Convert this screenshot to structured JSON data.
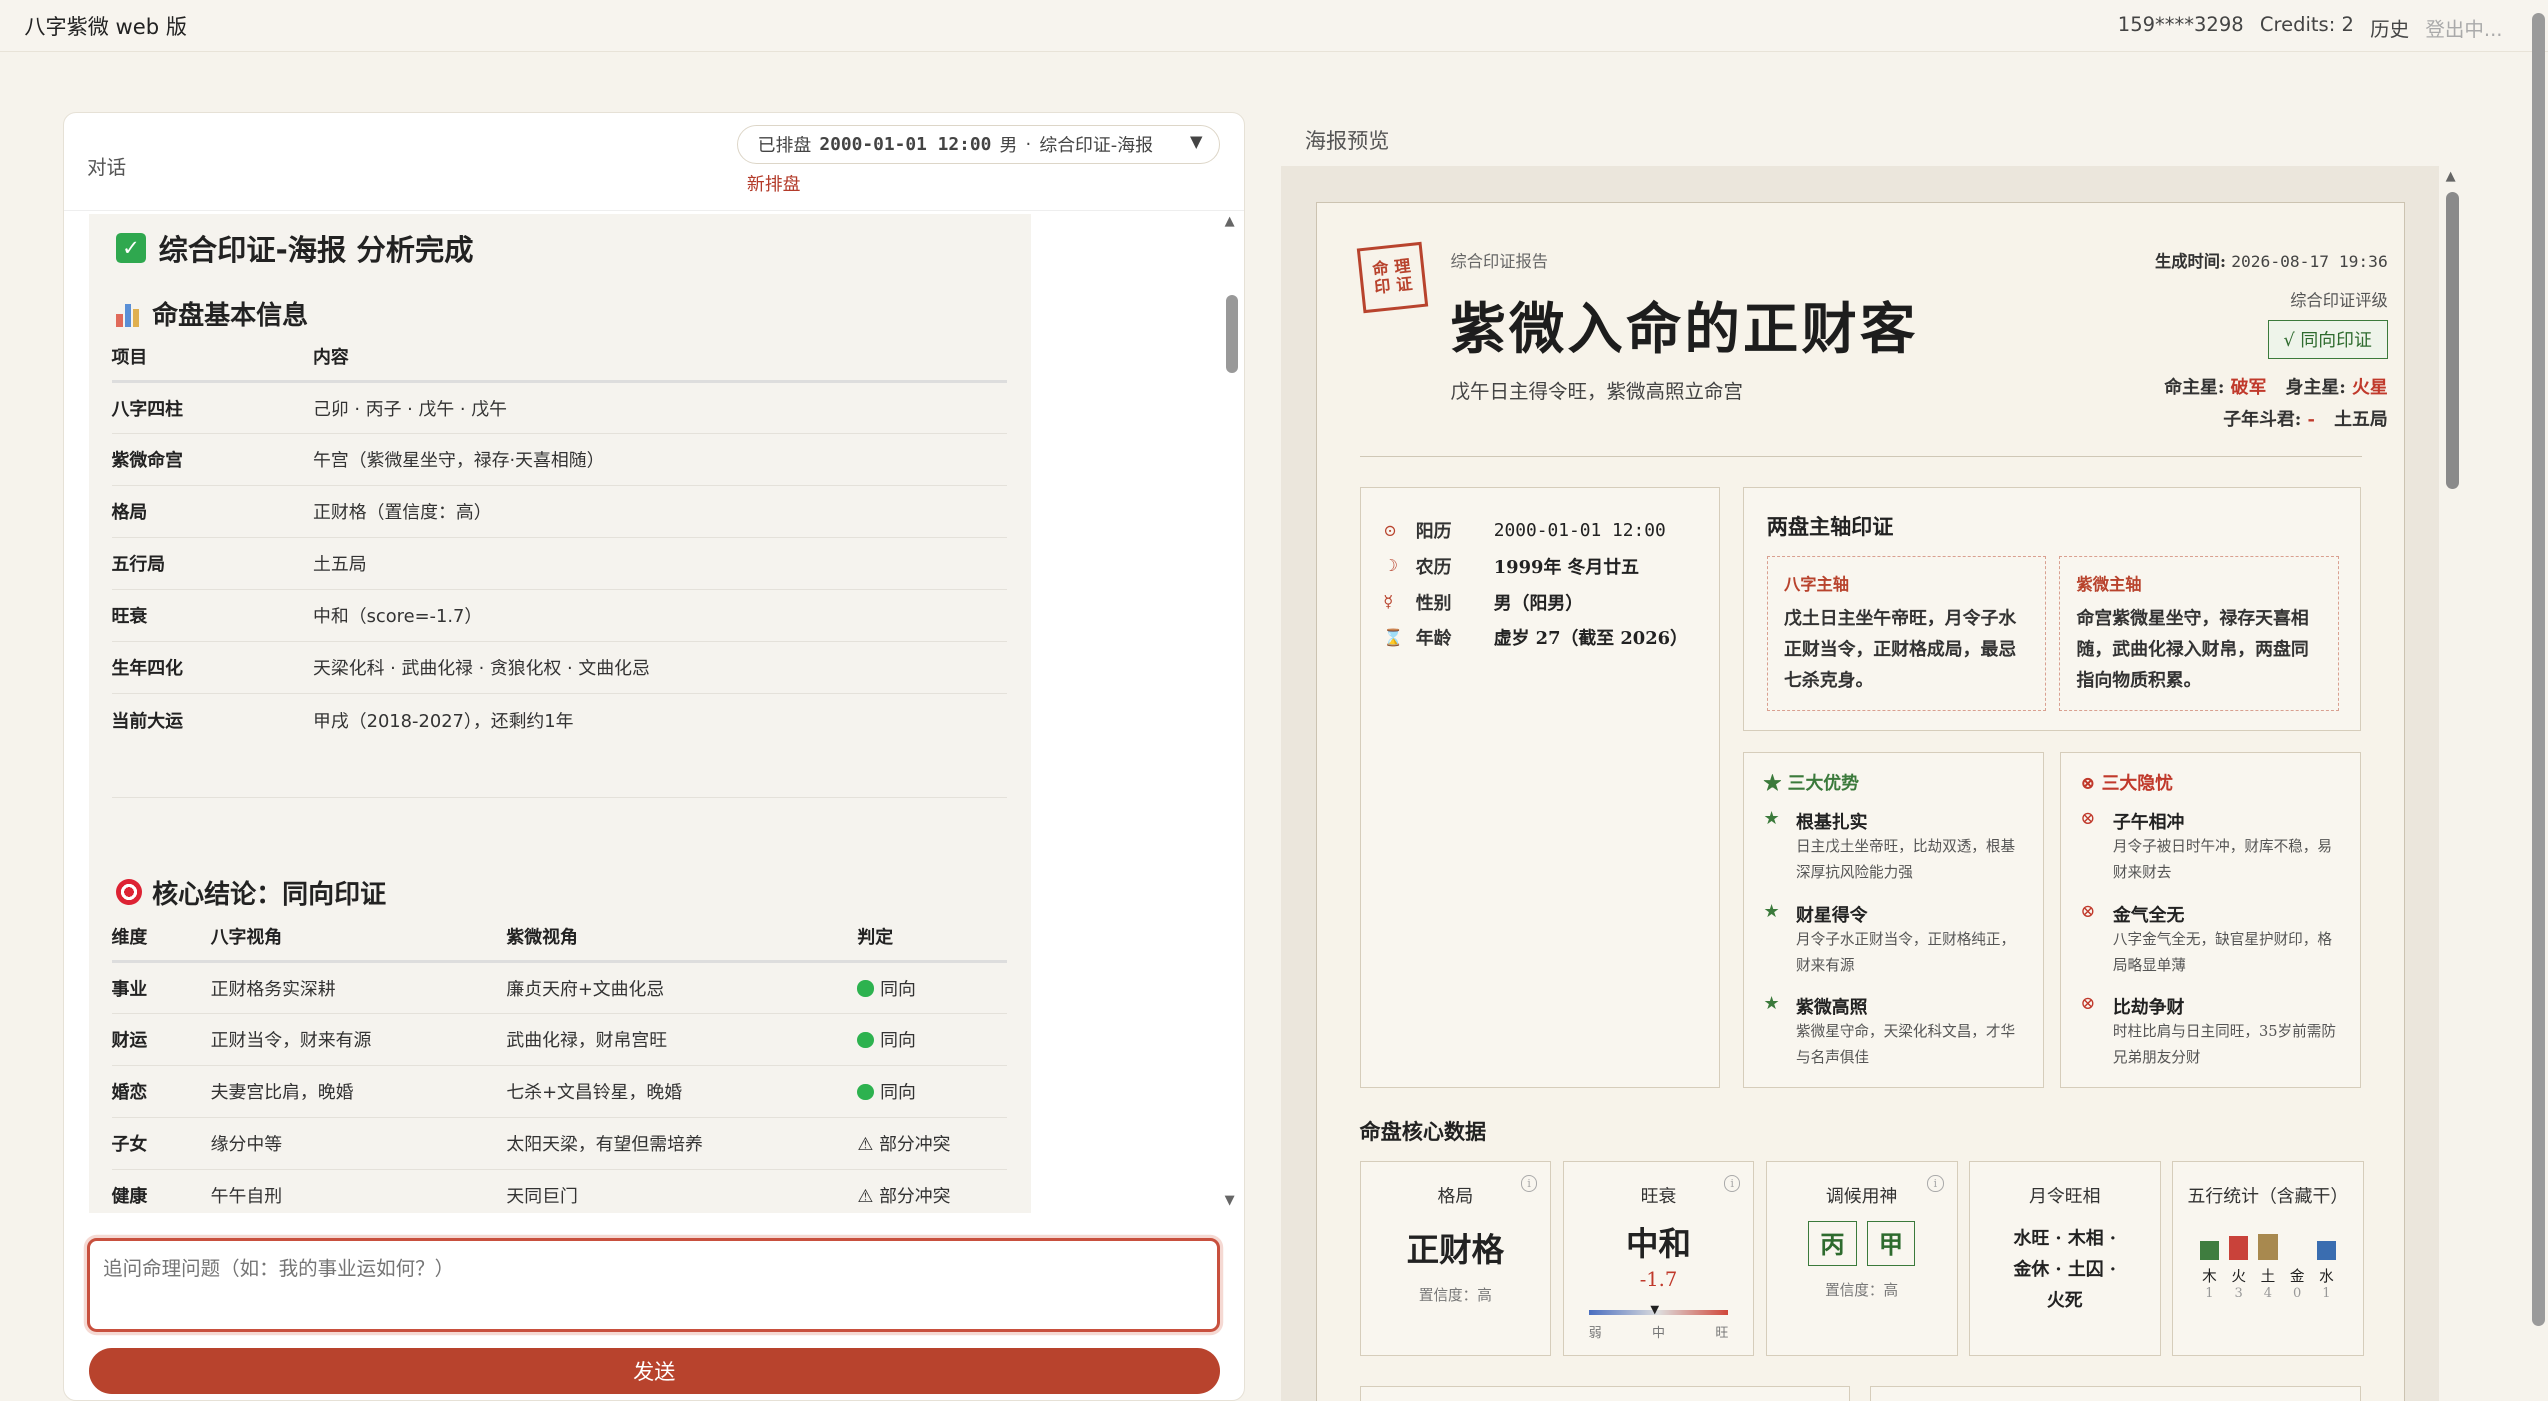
{
  "app": {
    "title": "八字紫微 web 版"
  },
  "topnav": {
    "phone": "159****3298",
    "credits": "Credits: 2",
    "history": "历史",
    "logout": "登出中..."
  },
  "chat": {
    "title": "对话",
    "selector": {
      "status": "已排盘",
      "datetime": "2000-01-01 12:00",
      "gender": "男",
      "sep": "·",
      "mode": "综合印证-海报"
    },
    "new_chart": "新排盘",
    "heading": "综合印证-海报 分析完成",
    "basic": {
      "heading": "命盘基本信息",
      "headers": [
        "项目",
        "内容"
      ],
      "rows": [
        {
          "k": "八字四柱",
          "v": "己卯 · 丙子 · 戊午 · 戊午"
        },
        {
          "k": "紫微命宫",
          "v": "午宫（紫微星坐守，禄存·天喜相随）"
        },
        {
          "k": "格局",
          "v": "正财格（置信度：高）"
        },
        {
          "k": "五行局",
          "v": "土五局"
        },
        {
          "k": "旺衰",
          "v": "中和（score=-1.7）"
        },
        {
          "k": "生年四化",
          "v": "天梁化科 · 武曲化禄 · 贪狼化权 · 文曲化忌"
        },
        {
          "k": "当前大运",
          "v": "甲戌（2018-2027），还剩约1年"
        }
      ]
    },
    "core": {
      "heading": "核心结论：同向印证",
      "headers": [
        "维度",
        "八字视角",
        "紫微视角",
        "判定"
      ],
      "rows": [
        {
          "a": "事业",
          "b": "正财格务实深耕",
          "c": "廉贞天府+文曲化忌",
          "d": "同向",
          "ok": true
        },
        {
          "a": "财运",
          "b": "正财当令，财来有源",
          "c": "武曲化禄，财帛宫旺",
          "d": "同向",
          "ok": true
        },
        {
          "a": "婚恋",
          "b": "夫妻宫比肩，晚婚",
          "c": "七杀+文昌铃星，晚婚",
          "d": "同向",
          "ok": true
        },
        {
          "a": "子女",
          "b": "缘分中等",
          "c": "太阳天梁，有望但需培养",
          "d": "⚠ 部分冲突",
          "ok": false
        },
        {
          "a": "健康",
          "b": "午午自刑",
          "c": "天同巨门",
          "d": "⚠ 部分冲突",
          "ok": false
        }
      ]
    },
    "input_placeholder": "追问命理问题（如：我的事业运如何？）",
    "send": "发送"
  },
  "preview": {
    "title": "海报预览",
    "seal": [
      "命 理",
      "印 证"
    ],
    "kicker": "综合印证报告",
    "headline": "紫微入命的正财客",
    "subtitle": "戊午日主得令旺，紫微高照立命宫",
    "gen_label": "生成时间:",
    "gen_time": "2026-08-17 19:36",
    "grade_label": "综合印证评级",
    "badge": "√ 同向印证",
    "ming_label": "命主星:",
    "ming": "破军",
    "shen_label": "身主星:",
    "shen": "火星",
    "dou_label": "子年斗君:",
    "dou": "-",
    "ju": "土五局",
    "birth": [
      {
        "icon": "⊙",
        "label": "阳历",
        "value": "2000-01-01 12:00"
      },
      {
        "icon": "☽",
        "label": "农历",
        "value": "1999年 冬月廿五"
      },
      {
        "icon": "☿",
        "label": "性别",
        "value": "男（阳男）"
      },
      {
        "icon": "⌛",
        "label": "年龄",
        "value": "虚岁 27（截至 2026）"
      }
    ],
    "axis": {
      "heading": "两盘主轴印证",
      "bazi_t": "八字主轴",
      "bazi": "戊土日主坐午帝旺，月令子水正财当令，正财格成局，最忌七杀克身。",
      "ziwei_t": "紫微主轴",
      "ziwei": "命宫紫微星坐守，禄存天喜相随，武曲化禄入财帛，两盘同指向物质积累。"
    },
    "advantages": {
      "heading": "三大优势",
      "items": [
        {
          "n": "根基扎实",
          "d": "日主戊土坐帝旺，比劫双透，根基深厚抗风险能力强"
        },
        {
          "n": "财星得令",
          "d": "月令子水正财当令，正财格纯正，财来有源"
        },
        {
          "n": "紫微高照",
          "d": "紫微星守命，天梁化科文昌，才华与名声俱佳"
        }
      ]
    },
    "risks": {
      "heading": "三大隐忧",
      "items": [
        {
          "n": "子午相冲",
          "d": "月令子被日时午冲，财库不稳，易财来财去"
        },
        {
          "n": "金气全无",
          "d": "八字金气全无，缺官星护财印，格局略显单薄"
        },
        {
          "n": "比劫争财",
          "d": "时柱比肩与日主同旺，35岁前需防兄弟朋友分财"
        }
      ]
    },
    "core_heading": "命盘核心数据",
    "cards": {
      "geju": {
        "t": "格局",
        "v": "正财格",
        "s": "置信度：高"
      },
      "wangshuai": {
        "t": "旺衰",
        "v": "中和",
        "score": "-1.7",
        "low": "弱",
        "mid": "中",
        "high": "旺"
      },
      "yongshen": {
        "t": "调候用神",
        "a": "丙",
        "b": "甲",
        "s": "置信度：高"
      },
      "yueling": {
        "t": "月令旺相",
        "l1": "水旺 · 木相 ·",
        "l2": "金休 · 土囚 ·",
        "l3": "火死"
      },
      "wuxing": {
        "t": "五行统计（含藏干）",
        "items": [
          {
            "n": "木",
            "c": "1",
            "color": "#3f7d3f",
            "level": 1
          },
          {
            "n": "火",
            "c": "3",
            "color": "#c9423a",
            "level": 3
          },
          {
            "n": "土",
            "c": "4",
            "color": "#a8894f",
            "level": 4
          },
          {
            "n": "金",
            "c": "0",
            "color": "#bbbbbb",
            "level": 0
          },
          {
            "n": "水",
            "c": "1",
            "color": "#3a6db0",
            "level": 1
          }
        ]
      }
    }
  }
}
